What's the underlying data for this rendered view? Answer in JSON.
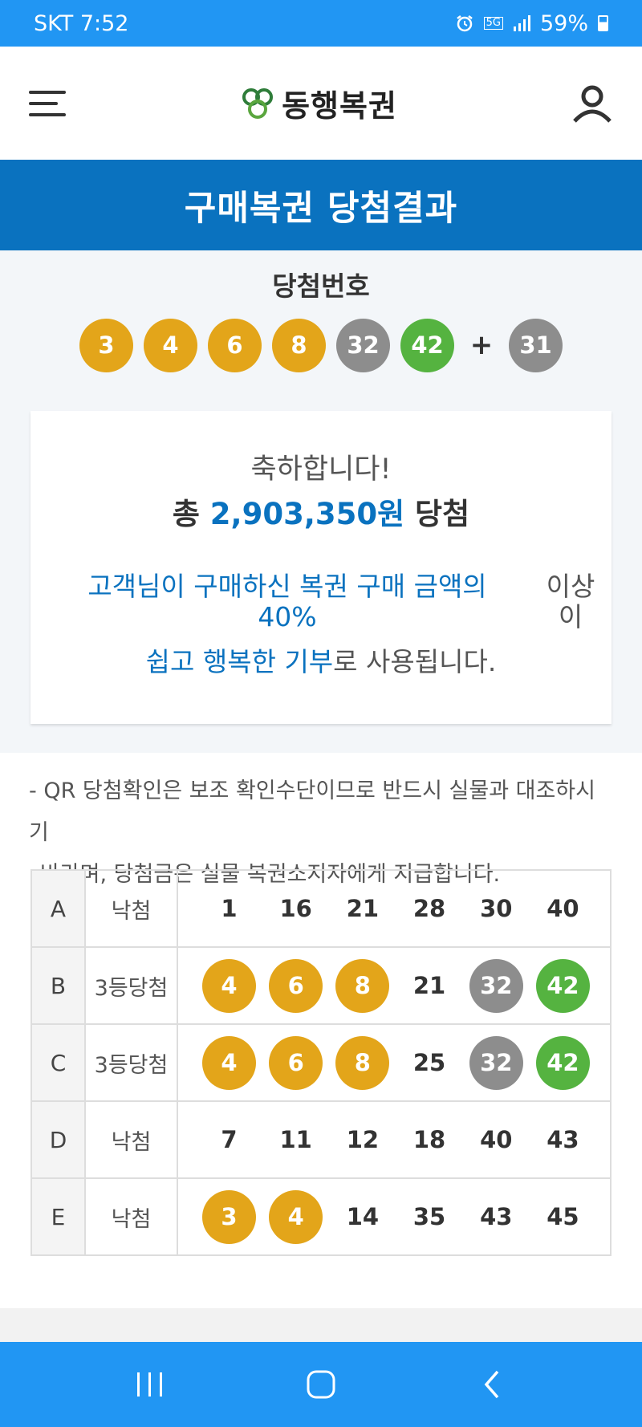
{
  "status_bar": {
    "carrier_time": "SKT 7:52",
    "network": "5G",
    "battery": "59%"
  },
  "header": {
    "logo_text": "동행복권"
  },
  "page_title": "구매복권 당첨결과",
  "winning": {
    "label": "당첨번호",
    "numbers": [
      {
        "value": "3",
        "color": "#e3a51a"
      },
      {
        "value": "4",
        "color": "#e3a51a"
      },
      {
        "value": "6",
        "color": "#e3a51a"
      },
      {
        "value": "8",
        "color": "#e3a51a"
      },
      {
        "value": "32",
        "color": "#8d8d8d"
      },
      {
        "value": "42",
        "color": "#55b340"
      }
    ],
    "plus": "+",
    "bonus": {
      "value": "31",
      "color": "#8d8d8d"
    }
  },
  "result": {
    "congrats": "축하합니다!",
    "total_prefix": "총 ",
    "total_amount": "2,903,350원",
    "total_suffix": " 당첨",
    "donate_line1": "고객님이 구매하신 복권 구매 금액의 40%",
    "donate_side": "이상이",
    "donate_line2_highlight": "쉽고 행복한 기부",
    "donate_line2_rest": "로 사용됩니다."
  },
  "notice": {
    "line1": "- QR 당첨확인은 보조 확인수단이므로 반드시 실물과 대조하시기",
    "line2": "바라며, 당첨금은 실물 복권소지자에게 지급합니다."
  },
  "games": [
    {
      "game": "A",
      "result": "낙첨",
      "numbers": [
        {
          "v": "1",
          "c": "plain"
        },
        {
          "v": "16",
          "c": "plain"
        },
        {
          "v": "21",
          "c": "plain"
        },
        {
          "v": "28",
          "c": "plain"
        },
        {
          "v": "30",
          "c": "plain"
        },
        {
          "v": "40",
          "c": "plain"
        }
      ]
    },
    {
      "game": "B",
      "result": "3등당첨",
      "numbers": [
        {
          "v": "4",
          "c": "y"
        },
        {
          "v": "6",
          "c": "y"
        },
        {
          "v": "8",
          "c": "y"
        },
        {
          "v": "21",
          "c": "plain"
        },
        {
          "v": "32",
          "c": "g"
        },
        {
          "v": "42",
          "c": "gr"
        }
      ]
    },
    {
      "game": "C",
      "result": "3등당첨",
      "numbers": [
        {
          "v": "4",
          "c": "y"
        },
        {
          "v": "6",
          "c": "y"
        },
        {
          "v": "8",
          "c": "y"
        },
        {
          "v": "25",
          "c": "plain"
        },
        {
          "v": "32",
          "c": "g"
        },
        {
          "v": "42",
          "c": "gr"
        }
      ]
    },
    {
      "game": "D",
      "result": "낙첨",
      "numbers": [
        {
          "v": "7",
          "c": "plain"
        },
        {
          "v": "11",
          "c": "plain"
        },
        {
          "v": "12",
          "c": "plain"
        },
        {
          "v": "18",
          "c": "plain"
        },
        {
          "v": "40",
          "c": "plain"
        },
        {
          "v": "43",
          "c": "plain"
        }
      ]
    },
    {
      "game": "E",
      "result": "낙첨",
      "numbers": [
        {
          "v": "3",
          "c": "y"
        },
        {
          "v": "4",
          "c": "y"
        },
        {
          "v": "14",
          "c": "plain"
        },
        {
          "v": "35",
          "c": "plain"
        },
        {
          "v": "43",
          "c": "plain"
        },
        {
          "v": "45",
          "c": "plain"
        }
      ]
    }
  ],
  "icons": {
    "menu": "hamburger-menu-icon",
    "user": "user-icon",
    "nav_recent": "recent-apps-icon",
    "nav_home": "home-icon",
    "nav_back": "back-icon"
  }
}
